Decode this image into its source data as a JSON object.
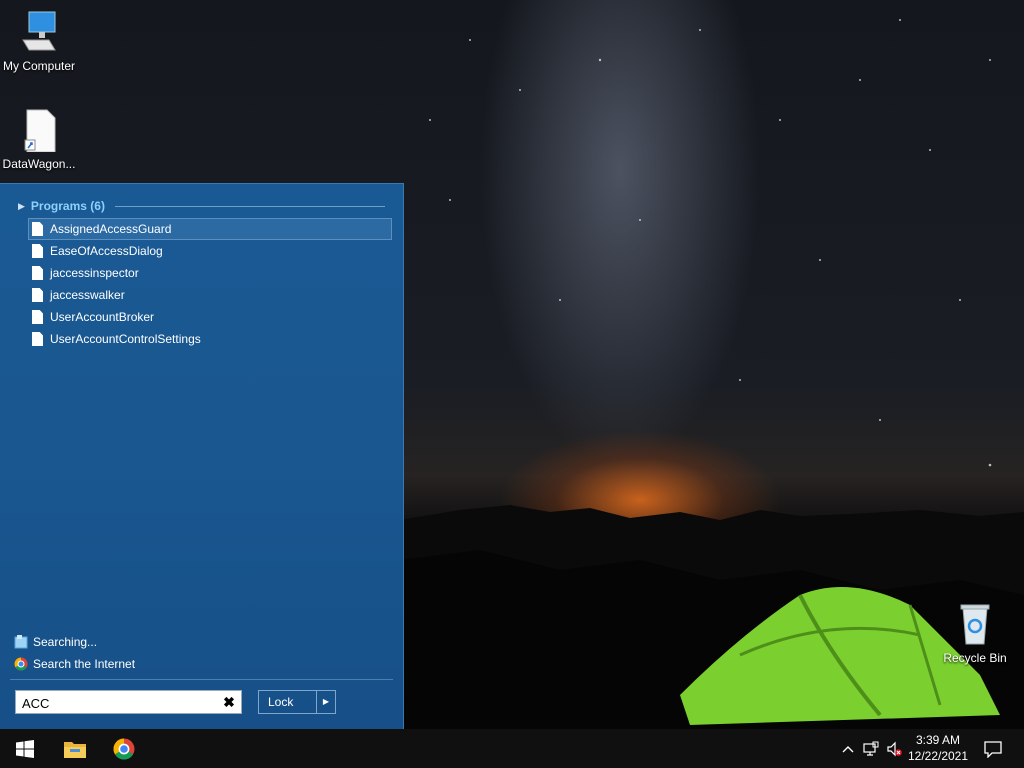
{
  "desktop": {
    "icons": [
      {
        "label": "My Computer",
        "icon": "computer-icon"
      },
      {
        "label": "DataWagon...",
        "icon": "file-shortcut-icon"
      },
      {
        "label": "Recycle Bin",
        "icon": "recycle-bin-icon"
      }
    ]
  },
  "start_menu": {
    "section_title": "Programs (6)",
    "results": [
      {
        "label": "AssignedAccessGuard",
        "selected": true
      },
      {
        "label": "EaseOfAccessDialog",
        "selected": false
      },
      {
        "label": "jaccessinspector",
        "selected": false
      },
      {
        "label": "jaccesswalker",
        "selected": false
      },
      {
        "label": "UserAccountBroker",
        "selected": false
      },
      {
        "label": "UserAccountControlSettings",
        "selected": false
      }
    ],
    "searching_label": "Searching...",
    "search_internet_label": "Search the Internet",
    "search": {
      "value": "ACC",
      "placeholder": ""
    },
    "lock_label": "Lock"
  },
  "taskbar": {
    "apps": [
      "windows-start-icon",
      "file-explorer-icon",
      "chrome-icon"
    ],
    "time": "3:39 AM",
    "date": "12/22/2021"
  },
  "colors": {
    "start_menu_bg": "#1a5791",
    "section_title": "#8fd0ff",
    "taskbar_bg": "#101010"
  }
}
